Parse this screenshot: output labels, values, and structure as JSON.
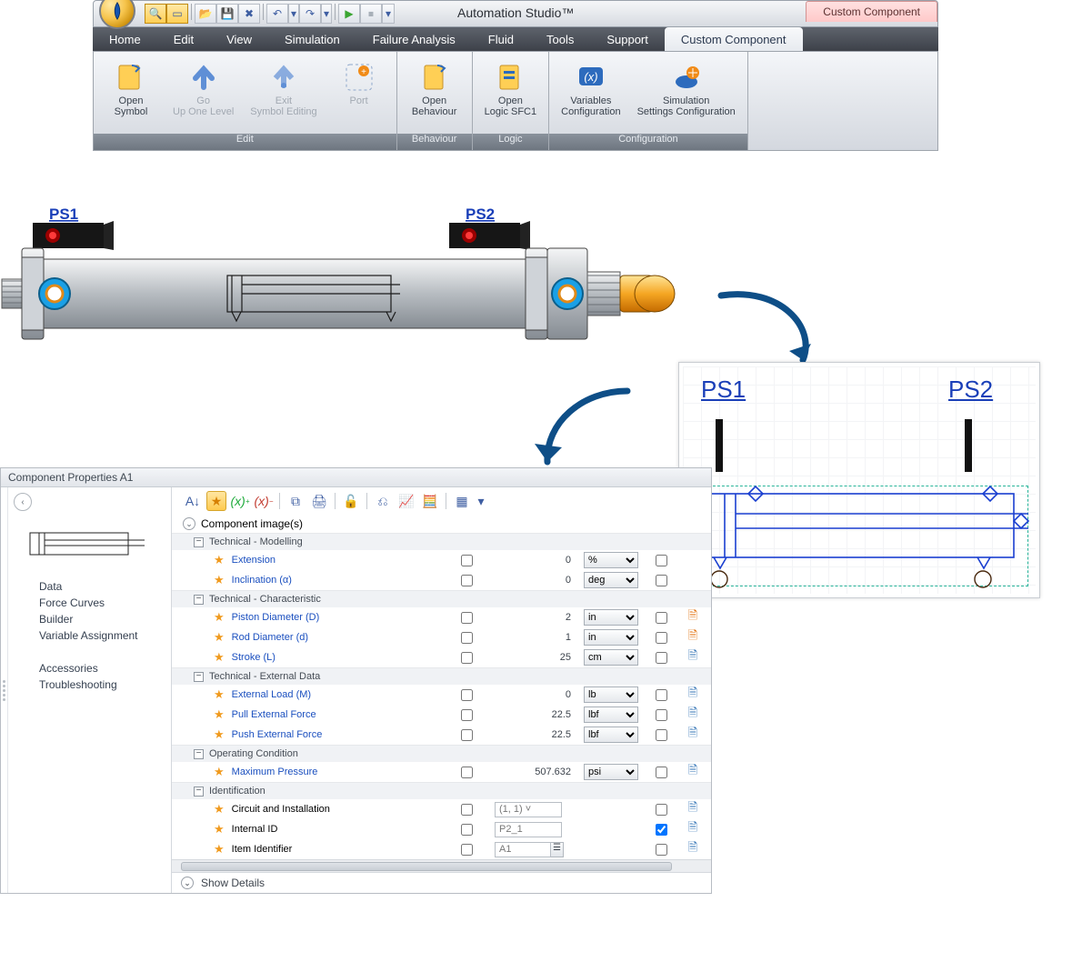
{
  "app_title": "Automation Studio™",
  "context_tab": "Custom Component",
  "menu": [
    "Home",
    "Edit",
    "View",
    "Simulation",
    "Failure Analysis",
    "Fluid",
    "Tools",
    "Support",
    "Custom Component"
  ],
  "menu_active_index": 8,
  "ribbon_groups": [
    {
      "title": "Edit",
      "buttons": [
        {
          "label": "Open Symbol",
          "disabled": false,
          "icon": "open-symbol"
        },
        {
          "label": "Go Up One Level",
          "disabled": true,
          "icon": "up-arrow"
        },
        {
          "label": "Exit Symbol Editing",
          "disabled": true,
          "icon": "exit-arrow"
        },
        {
          "label": "Port",
          "disabled": true,
          "icon": "port"
        }
      ]
    },
    {
      "title": "Behaviour",
      "buttons": [
        {
          "label": "Open Behaviour",
          "disabled": false,
          "icon": "open-doc"
        }
      ]
    },
    {
      "title": "Logic",
      "buttons": [
        {
          "label": "Open Logic SFC1",
          "disabled": false,
          "icon": "open-logic"
        }
      ]
    },
    {
      "title": "Configuration",
      "buttons": [
        {
          "label": "Variables Configuration",
          "disabled": false,
          "icon": "vars"
        },
        {
          "label": "Simulation Settings Configuration",
          "disabled": false,
          "icon": "sim-settings"
        }
      ]
    }
  ],
  "cylinder": {
    "ps1": "PS1",
    "ps2": "PS2"
  },
  "symbol_preview": {
    "ps1": "PS1",
    "ps2": "PS2"
  },
  "panel": {
    "title": "Component Properties A1",
    "nav": [
      "Data",
      "Force Curves",
      "Builder",
      "Variable Assignment",
      "",
      "Accessories",
      "Troubleshooting"
    ],
    "image_header": "Component image(s)",
    "footer": "Show Details",
    "groups": [
      {
        "name": "Technical - Modelling",
        "rows": [
          {
            "star": true,
            "name": "Extension",
            "link": true,
            "value": "0",
            "unit": "%",
            "ck": false
          },
          {
            "star": true,
            "name": "Inclination (α)",
            "link": true,
            "value": "0",
            "unit": "deg",
            "ck": false
          }
        ]
      },
      {
        "name": "Technical - Characteristic",
        "rows": [
          {
            "star": true,
            "name": "Piston Diameter (D)",
            "link": true,
            "value": "2",
            "unit": "in",
            "ck": false,
            "tail": "doc-orange"
          },
          {
            "star": true,
            "name": "Rod Diameter (d)",
            "link": true,
            "value": "1",
            "unit": "in",
            "ck": false,
            "tail": "doc-orange"
          },
          {
            "star": true,
            "name": "Stroke (L)",
            "link": true,
            "value": "25",
            "unit": "cm",
            "ck": false,
            "tail": "doc-blue"
          }
        ]
      },
      {
        "name": "Technical - External Data",
        "rows": [
          {
            "star": true,
            "name": "External Load (M)",
            "link": true,
            "value": "0",
            "unit": "lb",
            "ck": false,
            "tail": "doc-blue"
          },
          {
            "star": true,
            "name": "Pull External Force",
            "link": true,
            "value": "22.5",
            "unit": "lbf",
            "ck": false,
            "tail": "doc-blue"
          },
          {
            "star": true,
            "name": "Push External Force",
            "link": true,
            "value": "22.5",
            "unit": "lbf",
            "ck": false,
            "tail": "doc-blue"
          }
        ]
      },
      {
        "name": "Operating Condition",
        "rows": [
          {
            "star": true,
            "name": "Maximum Pressure",
            "link": true,
            "value": "507.632",
            "unit": "psi",
            "ck": false,
            "tail": "doc-blue"
          }
        ]
      },
      {
        "name": "Identification",
        "rows": [
          {
            "star": true,
            "name": "Circuit and Installation",
            "link": false,
            "valueInput": "(1, 1) ˅",
            "ck": false,
            "tail": "doc-blue"
          },
          {
            "star": true,
            "name": "Internal ID",
            "link": false,
            "valueInput": "P2_1",
            "ck": true,
            "tail": "doc-blue"
          },
          {
            "star": true,
            "name": "Item Identifier",
            "link": false,
            "valueInput": "A1",
            "lookup": true,
            "ck": false,
            "tail": "doc-blue"
          }
        ]
      }
    ]
  }
}
